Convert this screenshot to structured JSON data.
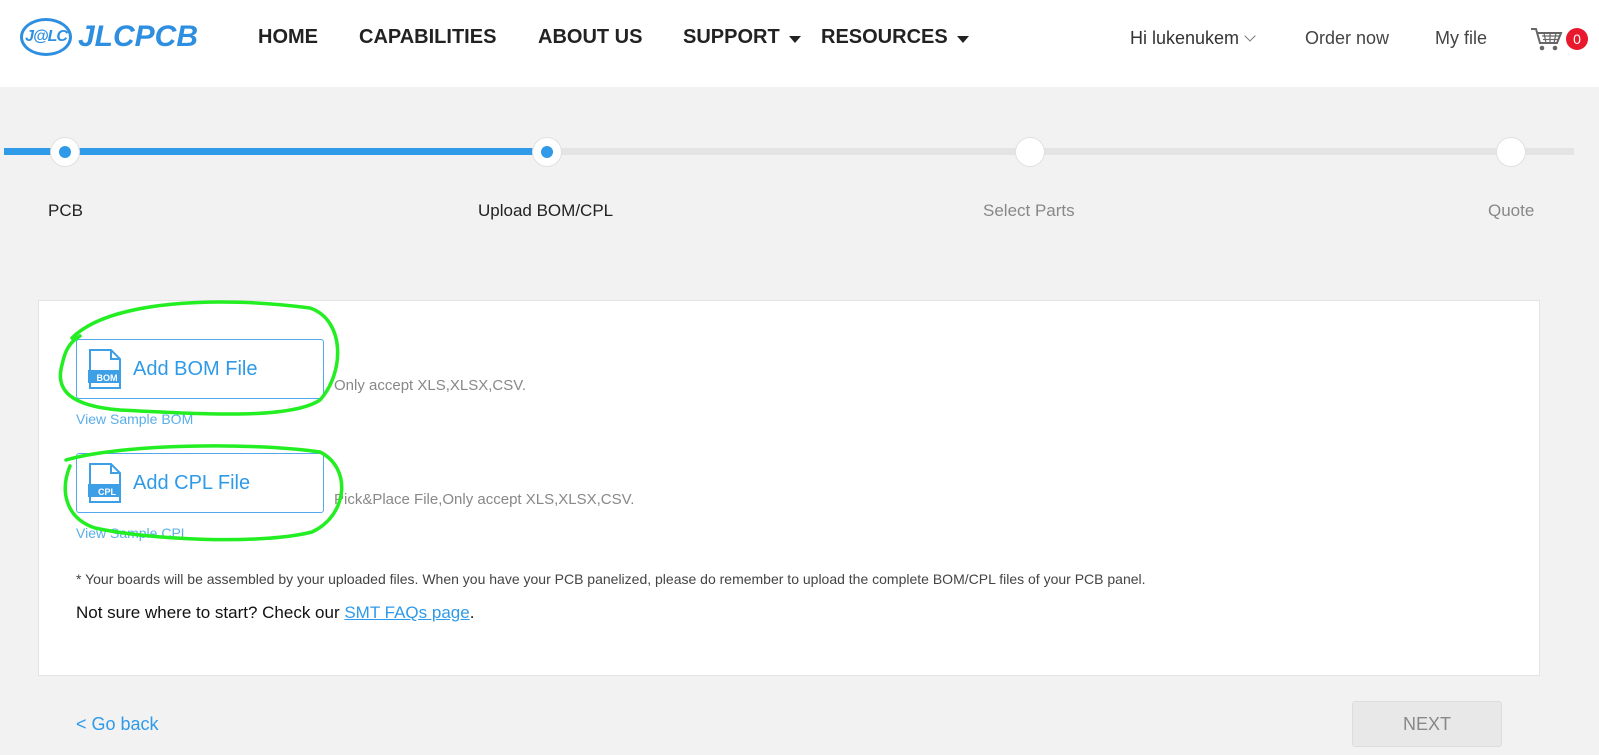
{
  "header": {
    "logo_badge": "J@LC",
    "logo_text": "JLCPCB",
    "nav": {
      "home": "HOME",
      "capabilities": "CAPABILITIES",
      "about": "ABOUT US",
      "support": "SUPPORT",
      "resources": "RESOURCES"
    },
    "user_greeting": "Hi lukenukem",
    "order_now": "Order now",
    "my_file": "My file",
    "cart_count": "0"
  },
  "steps": [
    {
      "label": "PCB",
      "state": "done"
    },
    {
      "label": "Upload BOM/CPL",
      "state": "current"
    },
    {
      "label": "Select Parts",
      "state": "todo"
    },
    {
      "label": "Quote",
      "state": "todo"
    }
  ],
  "upload": {
    "bom_button": "Add BOM File",
    "bom_icon_text": "BOM",
    "bom_hint": "Only accept XLS,XLSX,CSV.",
    "bom_sample": "View Sample BOM",
    "cpl_button": "Add CPL File",
    "cpl_icon_text": "CPL",
    "cpl_hint": "Pick&Place File,Only accept XLS,XLSX,CSV.",
    "cpl_sample": "View Sample CPL"
  },
  "note": "* Your boards will be assembled by your uploaded files. When you have your PCB panelized, please do remember to upload the complete BOM/CPL files of your PCB panel.",
  "faq": {
    "prefix": "Not sure where to start? Check our ",
    "link": "SMT FAQs page",
    "suffix": "."
  },
  "footer": {
    "go_back": "< Go back",
    "next": "NEXT"
  },
  "colors": {
    "accent": "#2f9ae8",
    "annotation": "#22ee22",
    "badge": "#e8192c"
  }
}
